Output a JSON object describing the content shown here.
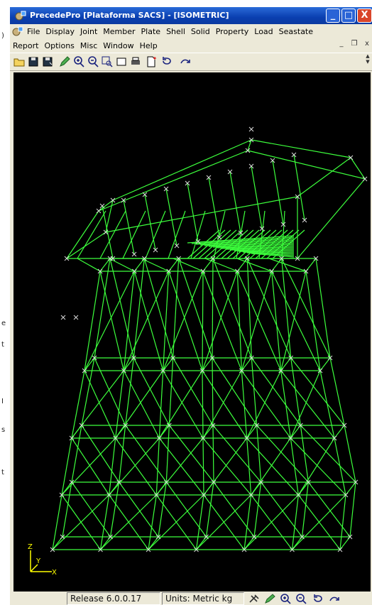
{
  "window": {
    "title": "PrecedePro  [Plataforma SACS] - [ISOMETRIC]",
    "controls": {
      "minimize": "_",
      "maximize": "□",
      "close": "X"
    }
  },
  "menu": {
    "row1": [
      "File",
      "Display",
      "Joint",
      "Member",
      "Plate",
      "Shell",
      "Solid",
      "Property",
      "Load",
      "Seastate"
    ],
    "row2": [
      "Report",
      "Options",
      "Misc",
      "Window",
      "Help"
    ],
    "mdi": {
      "minimize": "_",
      "restore": "❐",
      "close": "x"
    }
  },
  "left_marks": [
    ")",
    "e",
    "t",
    "I",
    "s",
    "t"
  ],
  "axes": {
    "z": "Z",
    "y": "Y",
    "x": "X"
  },
  "status": {
    "release": "Release 6.0.0.17",
    "units": "Units: Metric kg"
  },
  "colors": {
    "structure": "#3cff3c",
    "node": "#d8d8d8",
    "background": "#000000",
    "axis": "#ffff00"
  }
}
